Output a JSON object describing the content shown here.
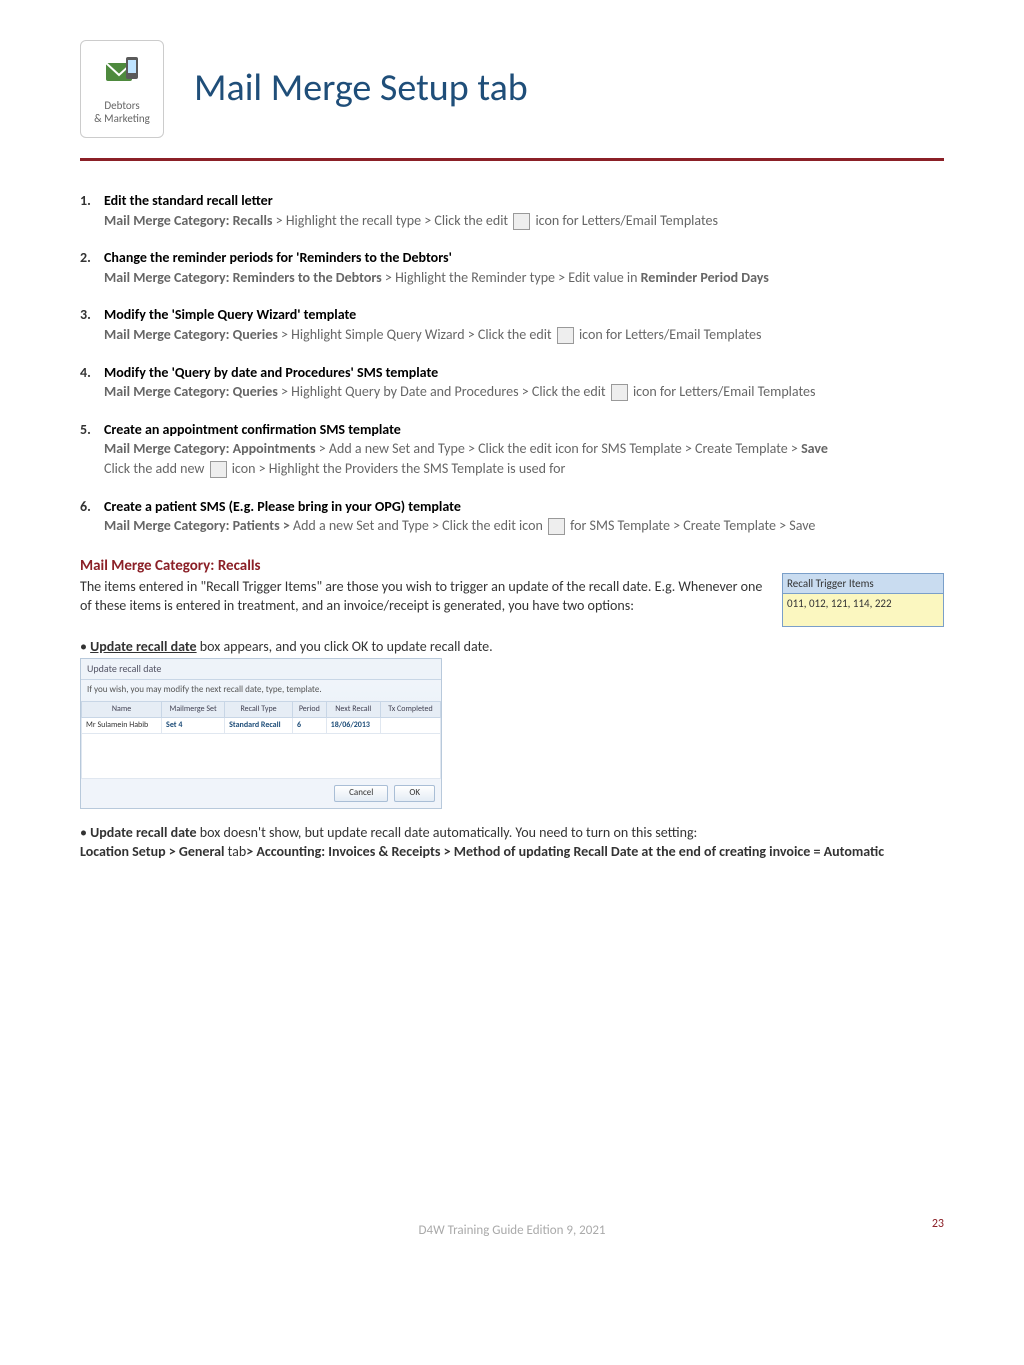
{
  "header": {
    "logo_line1": "Debtors",
    "logo_line2": "& Marketing",
    "title": "Mail Merge Setup tab"
  },
  "items": [
    {
      "num": "1.",
      "title": "Edit the standard recall letter",
      "bold": "Mail Merge Category: Recalls",
      "before": " > Highlight the recall type > Click the edit ",
      "after": " icon for Letters/Email Templates"
    },
    {
      "num": "2.",
      "title": "Change the reminder periods for 'Reminders to the Debtors'",
      "bold": "Mail Merge Category: Reminders to the Debtors",
      "before": " > Highlight the Reminder type > Edit value in ",
      "bold2": "Reminder Period Days"
    },
    {
      "num": "3.",
      "title": "Modify the 'Simple Query Wizard' template",
      "bold": "Mail Merge Category: Queries",
      "before": " > Highlight Simple Query Wizard > Click the edit ",
      "after": " icon  for Letters/Email Templates"
    },
    {
      "num": "4.",
      "title": "Modify the 'Query by date and Procedures' SMS template",
      "bold": "Mail Merge Category: Queries",
      "before": " > Highlight Query by Date and Procedures > Click the edit ",
      "after": " icon  for Letters/Email Templates"
    },
    {
      "num": "5.",
      "title": "Create an appointment confirmation SMS template",
      "bold": "Mail Merge Category: Appointments",
      "before": " > Add a new Set and Type > Click the edit icon  for SMS Template > Create Template > ",
      "bold2": "Save",
      "line2a": "Click the add new ",
      "line2b": "  icon > Highlight the Providers the SMS Template is used for"
    },
    {
      "num": "6.",
      "title": "Create a patient SMS (E.g. Please bring in your OPG) template",
      "bold": "Mail Merge Category: Patients > ",
      "before": "Add a new Set and Type > Click the edit icon ",
      "after": " for SMS Template > Create Template > Save"
    }
  ],
  "section": {
    "heading": "Mail Merge Category: Recalls",
    "p1": "The items entered in \"Recall Trigger Items\" are those you wish to trigger an update of the recall date. E.g. Whenever one of these items is entered in treatment, and an invoice/receipt is generated, you have two options:"
  },
  "recall_trigger": {
    "head": "Recall Trigger Items",
    "body": "011, 012, 121, 114, 222"
  },
  "bullet1": {
    "boldu": "Update recall date",
    "rest": " box appears, and you click OK to update recall date."
  },
  "dialog": {
    "title": "Update recall date",
    "hint": "If you wish, you may modify the next recall date, type, template.",
    "cols": [
      "Name",
      "Mailmerge Set",
      "Recall Type",
      "Period",
      "Next Recall",
      "Tx Completed"
    ],
    "row": {
      "name": "Mr Sulamein  Habib",
      "set": "Set 4",
      "type": "Standard Recall",
      "period": "6",
      "next": "18/06/2013",
      "tx": ""
    },
    "cancel": "Cancel",
    "ok": "OK"
  },
  "bullet2": {
    "bold": "Update recall date",
    "rest": " box doesn't show, but update recall date automatically. You need to turn on this setting:",
    "path": "Location Setup > General",
    "rest2": " tab",
    "path2": "> Accounting: Invoices & Receipts > Method of updating Recall Date at the end of creating invoice = Automatic"
  },
  "footer": {
    "text": "D4W Training Guide Edition 9, 2021",
    "page": "23"
  }
}
